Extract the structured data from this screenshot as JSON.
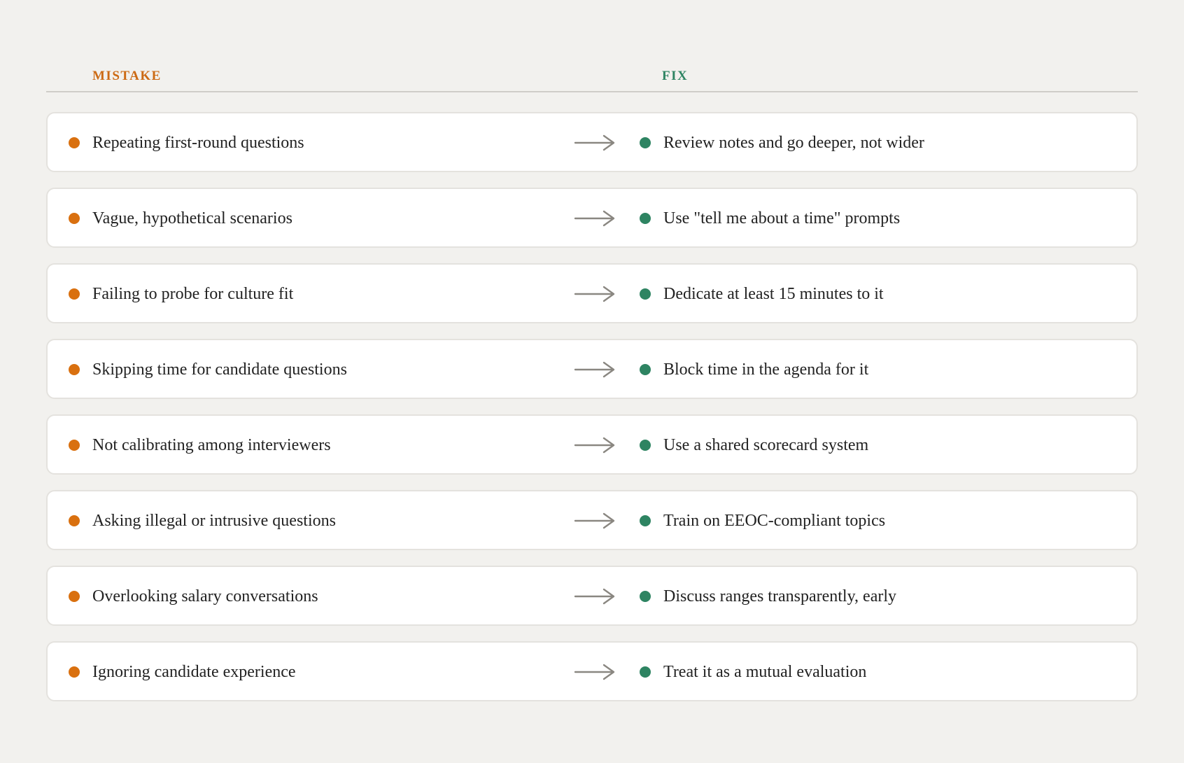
{
  "columns": {
    "mistake_label": "MISTAKE",
    "fix_label": "FIX"
  },
  "colors": {
    "mistake_accent": "#d9700f",
    "fix_accent": "#2e8462",
    "arrow": "#8a8781",
    "background": "#f2f1ee"
  },
  "icons": {
    "arrow": "right-arrow-icon",
    "mistake_marker": "orange-dot-icon",
    "fix_marker": "green-dot-icon"
  },
  "rows": [
    {
      "mistake": "Repeating first-round questions",
      "fix": "Review notes and go deeper, not wider"
    },
    {
      "mistake": "Vague, hypothetical scenarios",
      "fix": "Use \"tell me about a time\" prompts"
    },
    {
      "mistake": "Failing to probe for culture fit",
      "fix": "Dedicate at least 15 minutes to it"
    },
    {
      "mistake": "Skipping time for candidate questions",
      "fix": "Block time in the agenda for it"
    },
    {
      "mistake": "Not calibrating among interviewers",
      "fix": "Use a shared scorecard system"
    },
    {
      "mistake": "Asking illegal or intrusive questions",
      "fix": "Train on EEOC-compliant topics"
    },
    {
      "mistake": "Overlooking salary conversations",
      "fix": "Discuss ranges transparently, early"
    },
    {
      "mistake": "Ignoring candidate experience",
      "fix": "Treat it as a mutual evaluation"
    }
  ]
}
